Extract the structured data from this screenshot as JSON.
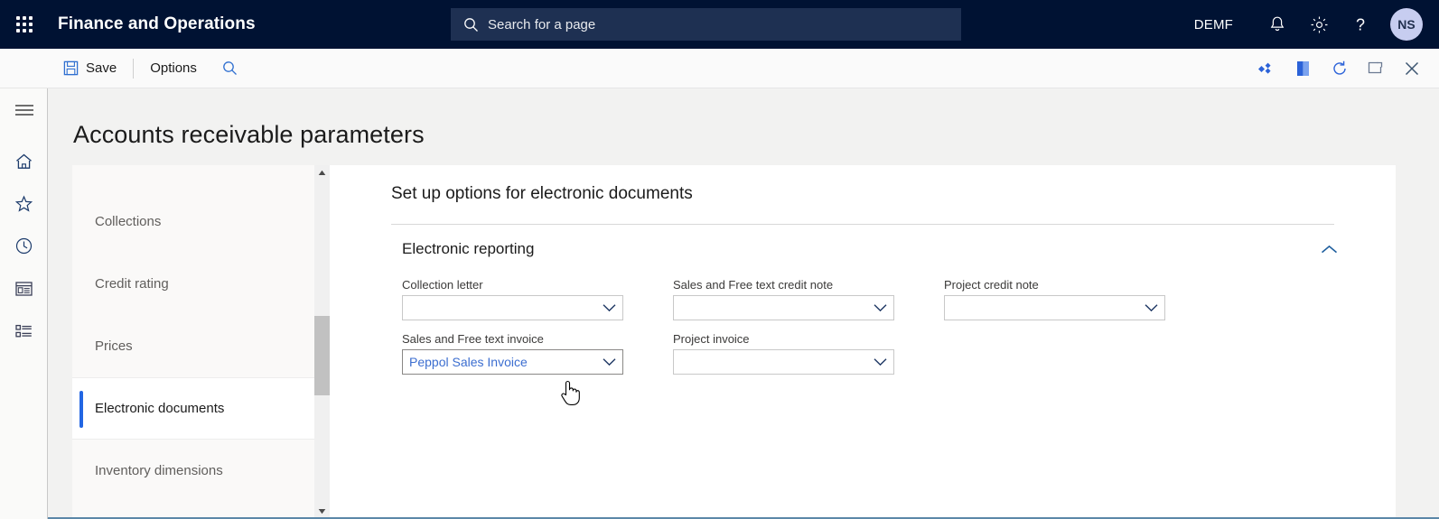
{
  "topbar": {
    "waffle_label": "app-launcher",
    "app_title": "Finance and Operations",
    "search": {
      "placeholder": "Search for a page",
      "icon": "search-icon"
    },
    "company": "DEMF",
    "icons": [
      {
        "name": "notifications-icon",
        "label": "Notifications"
      },
      {
        "name": "settings-gear-icon",
        "label": "Settings"
      },
      {
        "name": "help-question-icon",
        "label": "Help"
      }
    ],
    "avatar_initials": "NS"
  },
  "commandbar": {
    "save_label": "Save",
    "options_label": "Options",
    "search_icon": "search-icon",
    "right_icons": [
      {
        "name": "attachments-diamond-icon"
      },
      {
        "name": "open-in-office-icon"
      },
      {
        "name": "refresh-icon"
      },
      {
        "name": "popout-window-icon"
      },
      {
        "name": "close-icon"
      }
    ]
  },
  "rail": {
    "items": [
      {
        "name": "hamburger-menu-icon",
        "label": "Expand the navigation pane"
      },
      {
        "name": "home-icon",
        "label": "Home"
      },
      {
        "name": "favorites-star-icon",
        "label": "Favorites"
      },
      {
        "name": "recent-clock-icon",
        "label": "Recent"
      },
      {
        "name": "workspaces-icon",
        "label": "Workspaces"
      },
      {
        "name": "modules-list-icon",
        "label": "Modules"
      }
    ]
  },
  "page": {
    "title": "Accounts receivable parameters",
    "nav": {
      "items": [
        {
          "label": "Collections",
          "selected": false
        },
        {
          "label": "Credit rating",
          "selected": false
        },
        {
          "label": "Prices",
          "selected": false
        },
        {
          "label": "Electronic documents",
          "selected": true
        },
        {
          "label": "Inventory dimensions",
          "selected": false
        }
      ]
    },
    "scrollbar": {
      "up": "scroll-up-arrow",
      "down": "scroll-down-arrow"
    },
    "content": {
      "heading": "Set up options for electronic documents",
      "group": {
        "title": "Electronic reporting",
        "toggle_icon": "chevron-up-icon",
        "expanded": true,
        "fields_row1": [
          {
            "label": "Collection letter",
            "value": "",
            "name": "collection-letter"
          },
          {
            "label": "Sales and Free text credit note",
            "value": "",
            "name": "sales-free-text-credit-note"
          },
          {
            "label": "Project credit note",
            "value": "",
            "name": "project-credit-note"
          }
        ],
        "fields_row2": [
          {
            "label": "Sales and Free text invoice",
            "value": "Peppol Sales Invoice",
            "name": "sales-free-text-invoice",
            "focused": true
          },
          {
            "label": "Project invoice",
            "value": "",
            "name": "project-invoice"
          }
        ]
      }
    }
  },
  "colors": {
    "header_bg": "#001233",
    "search_bg": "#1e3052",
    "accent_blue": "#2266e3",
    "value_blue": "#3c6ed0",
    "page_bg": "#f2f2f1",
    "panel_bg": "#ffffff",
    "avatar_bg": "#c7cdf0",
    "bottom_border": "#5b87a8"
  }
}
